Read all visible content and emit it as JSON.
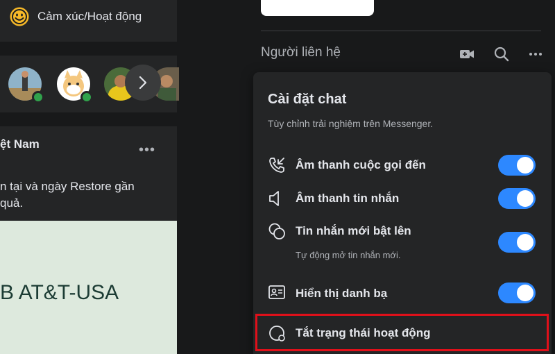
{
  "feed": {
    "feeling_activity_label": "Cảm xúc/Hoạt động",
    "post_author": "ệt Nam",
    "post_text": "n tại và ngày Restore gần\nquả.",
    "image_text": "B AT&T-USA"
  },
  "contacts": {
    "title": "Người liên hệ"
  },
  "chat_settings": {
    "title": "Cài đặt chat",
    "subtitle": "Tùy chỉnh trải nghiệm trên Messenger.",
    "items": [
      {
        "label": "Âm thanh cuộc gọi đến",
        "icon": "incoming-call-icon",
        "enabled": true
      },
      {
        "label": "Âm thanh tin nhắn",
        "icon": "speaker-icon",
        "enabled": true
      },
      {
        "label": "Tin nhắn mới bật lên",
        "description": "Tự động mở tin nhắn mới.",
        "icon": "chat-bubbles-icon",
        "enabled": true
      },
      {
        "label": "Hiển thị danh bạ",
        "icon": "contact-card-icon",
        "enabled": true
      },
      {
        "label": "Tắt trạng thái hoạt động",
        "icon": "active-status-icon"
      }
    ]
  },
  "colors": {
    "toggle_on": "#2d88ff",
    "highlight_border": "#e0101a",
    "online": "#31a24c"
  }
}
